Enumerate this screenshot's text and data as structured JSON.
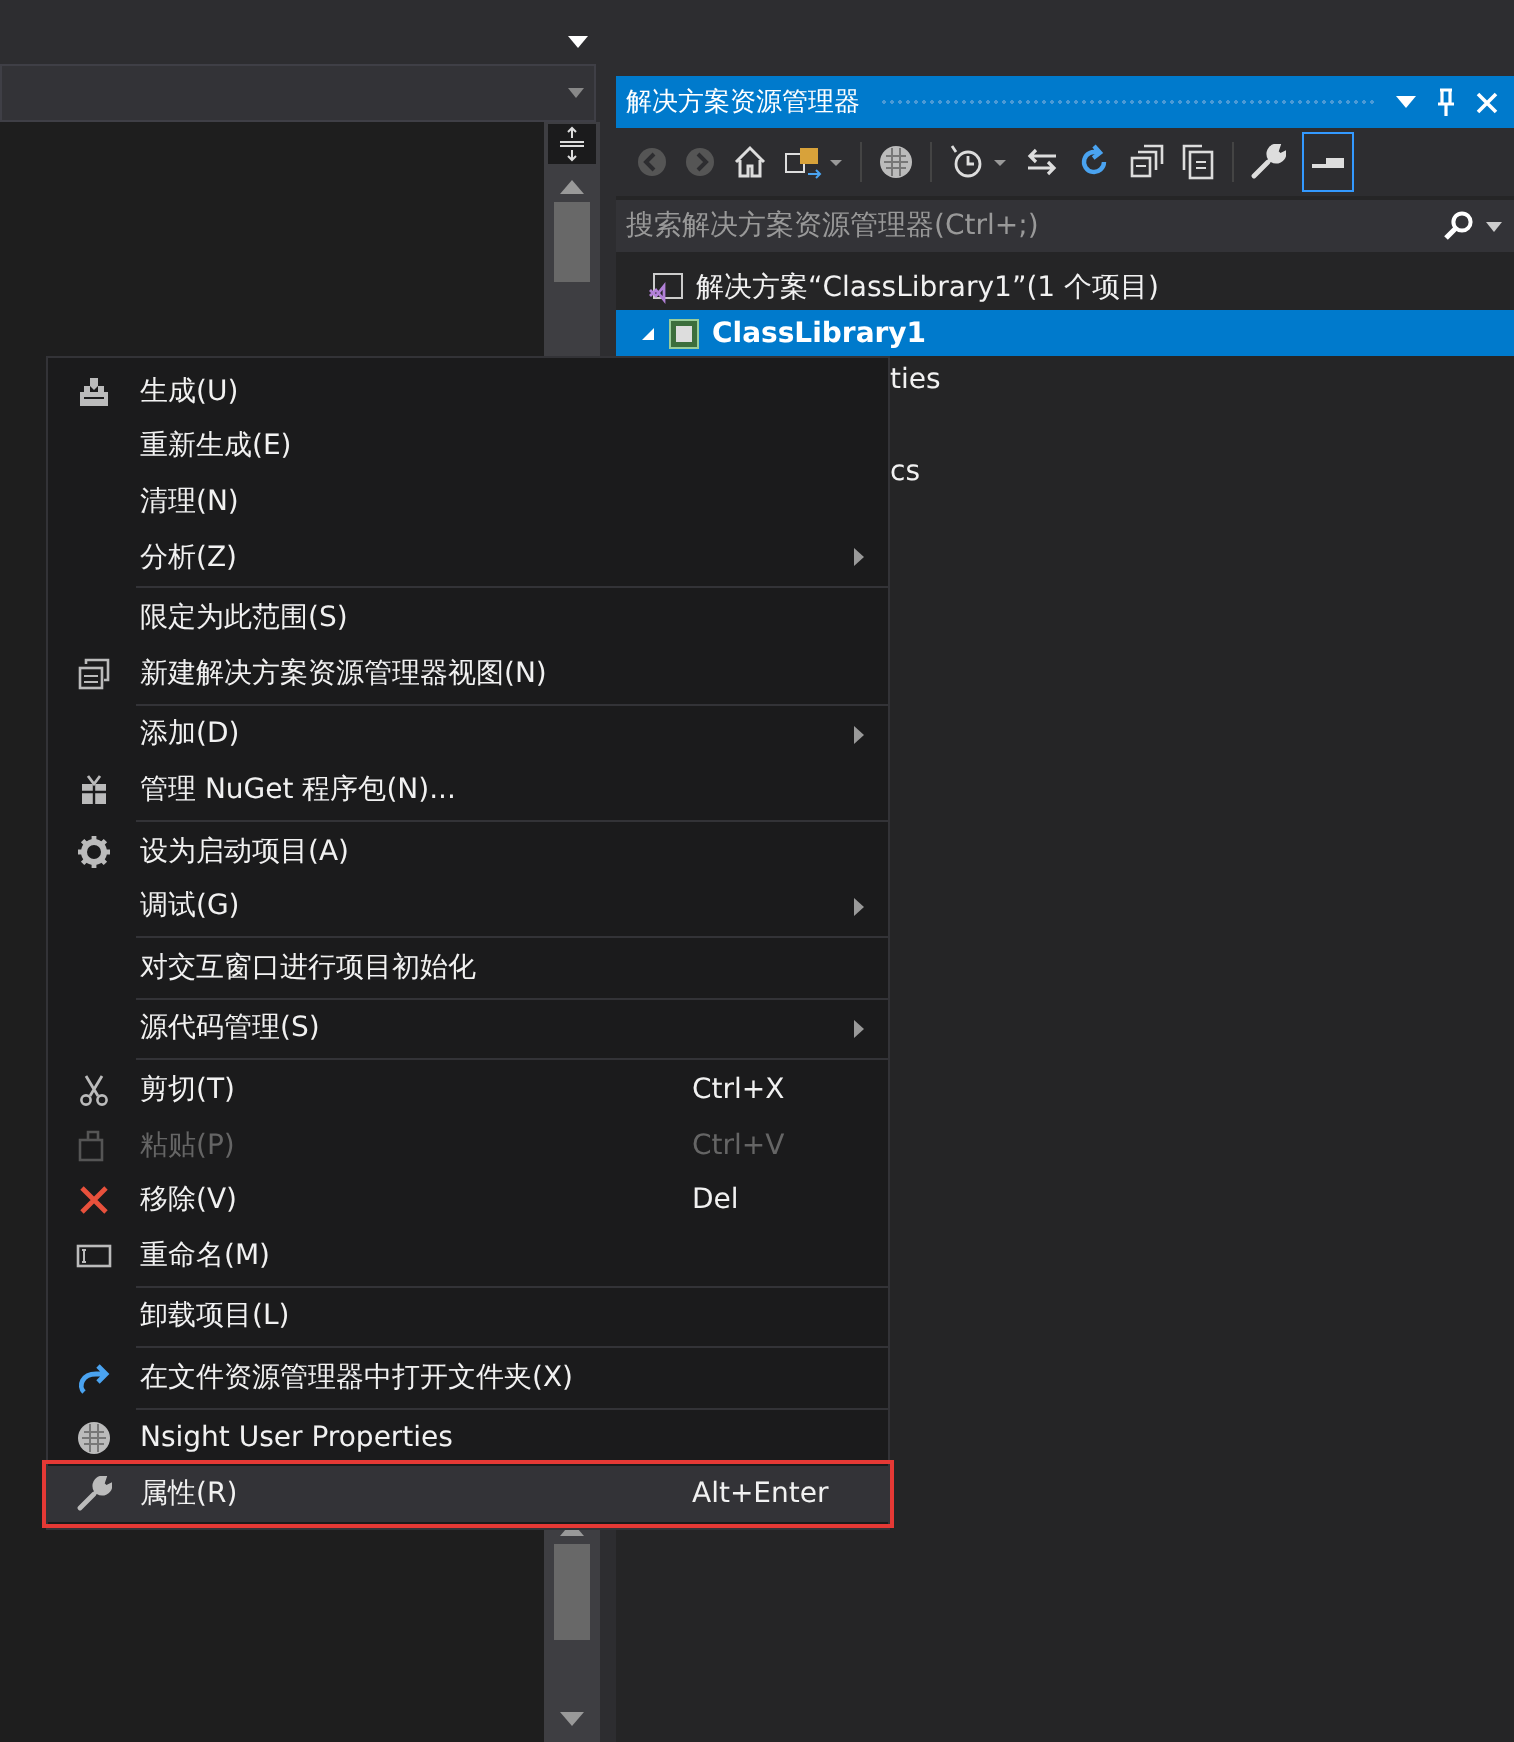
{
  "explorer": {
    "title": "解决方案资源管理器",
    "search": {
      "placeholder": "搜索解决方案资源管理器(Ctrl+;)"
    },
    "tree": [
      {
        "label": "解决方案“ClassLibrary1”(1 个项目)",
        "selected": false,
        "children": [
          {
            "label": "ClassLibrary1",
            "selected": true,
            "expanded": true,
            "children": [
              {
                "label": "ties",
                "selected": false
              },
              {
                "label": "cs",
                "selected": false
              }
            ]
          }
        ]
      }
    ]
  },
  "context_menu": {
    "groups": [
      {
        "items": [
          {
            "label": "生成(U)",
            "submenu": false,
            "disabled": false,
            "selected": false
          },
          {
            "label": "重新生成(E)",
            "submenu": false,
            "disabled": false,
            "selected": false
          },
          {
            "label": "清理(N)",
            "submenu": false,
            "disabled": false,
            "selected": false
          },
          {
            "label": "分析(Z)",
            "submenu": true,
            "disabled": false,
            "selected": false
          }
        ]
      },
      {
        "items": [
          {
            "label": "限定为此范围(S)",
            "submenu": false,
            "disabled": false,
            "selected": false
          },
          {
            "label": "新建解决方案资源管理器视图(N)",
            "submenu": false,
            "disabled": false,
            "selected": false
          }
        ]
      },
      {
        "items": [
          {
            "label": "添加(D)",
            "submenu": true,
            "disabled": false,
            "selected": false
          },
          {
            "label": "管理 NuGet 程序包(N)...",
            "submenu": false,
            "disabled": false,
            "selected": false
          }
        ]
      },
      {
        "items": [
          {
            "label": "设为启动项目(A)",
            "submenu": false,
            "disabled": false,
            "selected": false
          },
          {
            "label": "调试(G)",
            "submenu": true,
            "disabled": false,
            "selected": false
          }
        ]
      },
      {
        "items": [
          {
            "label": "对交互窗口进行项目初始化",
            "submenu": false,
            "disabled": false,
            "selected": false
          }
        ]
      },
      {
        "items": [
          {
            "label": "源代码管理(S)",
            "submenu": true,
            "disabled": false,
            "selected": false
          }
        ]
      },
      {
        "items": [
          {
            "label": "剪切(T)",
            "shortcut": "Ctrl+X",
            "submenu": false,
            "disabled": false,
            "selected": false
          },
          {
            "label": "粘贴(P)",
            "shortcut": "Ctrl+V",
            "submenu": false,
            "disabled": true,
            "selected": false
          },
          {
            "label": "移除(V)",
            "shortcut": "Del",
            "submenu": false,
            "disabled": false,
            "selected": false
          },
          {
            "label": "重命名(M)",
            "submenu": false,
            "disabled": false,
            "selected": false
          }
        ]
      },
      {
        "items": [
          {
            "label": "卸载项目(L)",
            "submenu": false,
            "disabled": false,
            "selected": false
          }
        ]
      },
      {
        "items": [
          {
            "label": "在文件资源管理器中打开文件夹(X)",
            "submenu": false,
            "disabled": false,
            "selected": false
          }
        ]
      },
      {
        "items": [
          {
            "label": "Nsight User Properties",
            "submenu": false,
            "disabled": false,
            "selected": false
          },
          {
            "label": "属性(R)",
            "shortcut": "Alt+Enter",
            "submenu": false,
            "disabled": false,
            "selected": true
          }
        ]
      }
    ]
  }
}
